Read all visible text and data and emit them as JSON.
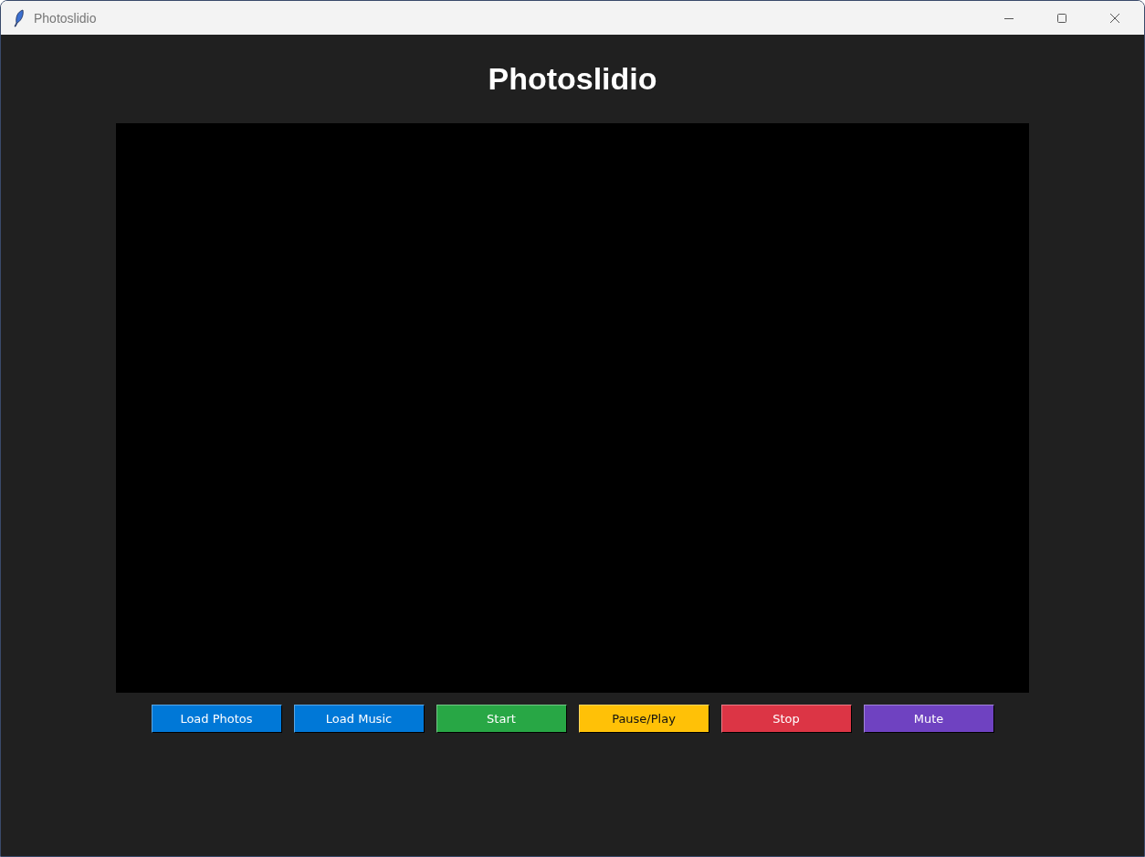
{
  "window": {
    "title": "Photoslidio"
  },
  "heading": "Photoslidio",
  "buttons": [
    {
      "label": "Load Photos",
      "color": "#0078d7"
    },
    {
      "label": "Load Music",
      "color": "#0078d7"
    },
    {
      "label": "Start",
      "color": "#28a745"
    },
    {
      "label": "Pause/Play",
      "color": "#ffc107"
    },
    {
      "label": "Stop",
      "color": "#dc3545"
    },
    {
      "label": "Mute",
      "color": "#6f42c1"
    }
  ]
}
